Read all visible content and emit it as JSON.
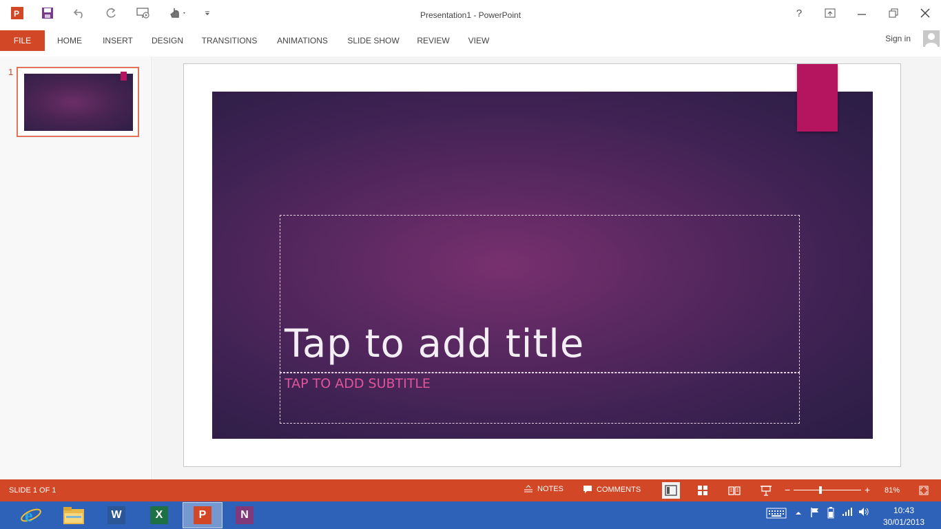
{
  "window": {
    "title": "Presentation1 - PowerPoint",
    "help_glyph": "?",
    "signin_label": "Sign in"
  },
  "ribbon": {
    "tabs": [
      {
        "label": "FILE"
      },
      {
        "label": "HOME"
      },
      {
        "label": "INSERT"
      },
      {
        "label": "DESIGN"
      },
      {
        "label": "TRANSITIONS"
      },
      {
        "label": "ANIMATIONS"
      },
      {
        "label": "SLIDE SHOW"
      },
      {
        "label": "REVIEW"
      },
      {
        "label": "VIEW"
      }
    ]
  },
  "thumbnails": {
    "items": [
      {
        "number": "1"
      }
    ]
  },
  "slide": {
    "title_placeholder": "Tap to add title",
    "subtitle_placeholder": "TAP TO ADD SUBTITLE",
    "background_colors": [
      "#78306f",
      "#2a1d44"
    ],
    "accent_color": "#b5145f",
    "subtitle_color": "#e0549a"
  },
  "statusbar": {
    "slide_count": "SLIDE 1 OF 1",
    "notes_label": "NOTES",
    "comments_label": "COMMENTS",
    "zoom_level": "81%",
    "zoom_value": 0.81
  },
  "taskbar": {
    "apps": [
      {
        "name": "Internet Explorer",
        "badge": "e"
      },
      {
        "name": "File Explorer",
        "badge": ""
      },
      {
        "name": "Word",
        "badge": "W"
      },
      {
        "name": "Excel",
        "badge": "X"
      },
      {
        "name": "PowerPoint",
        "badge": "P",
        "active": true
      },
      {
        "name": "OneNote",
        "badge": "N"
      }
    ],
    "clock_time": "10:43",
    "clock_date": "30/01/2013"
  },
  "theme": {
    "brand": "#d24726",
    "taskbar": "#2d62b8"
  }
}
